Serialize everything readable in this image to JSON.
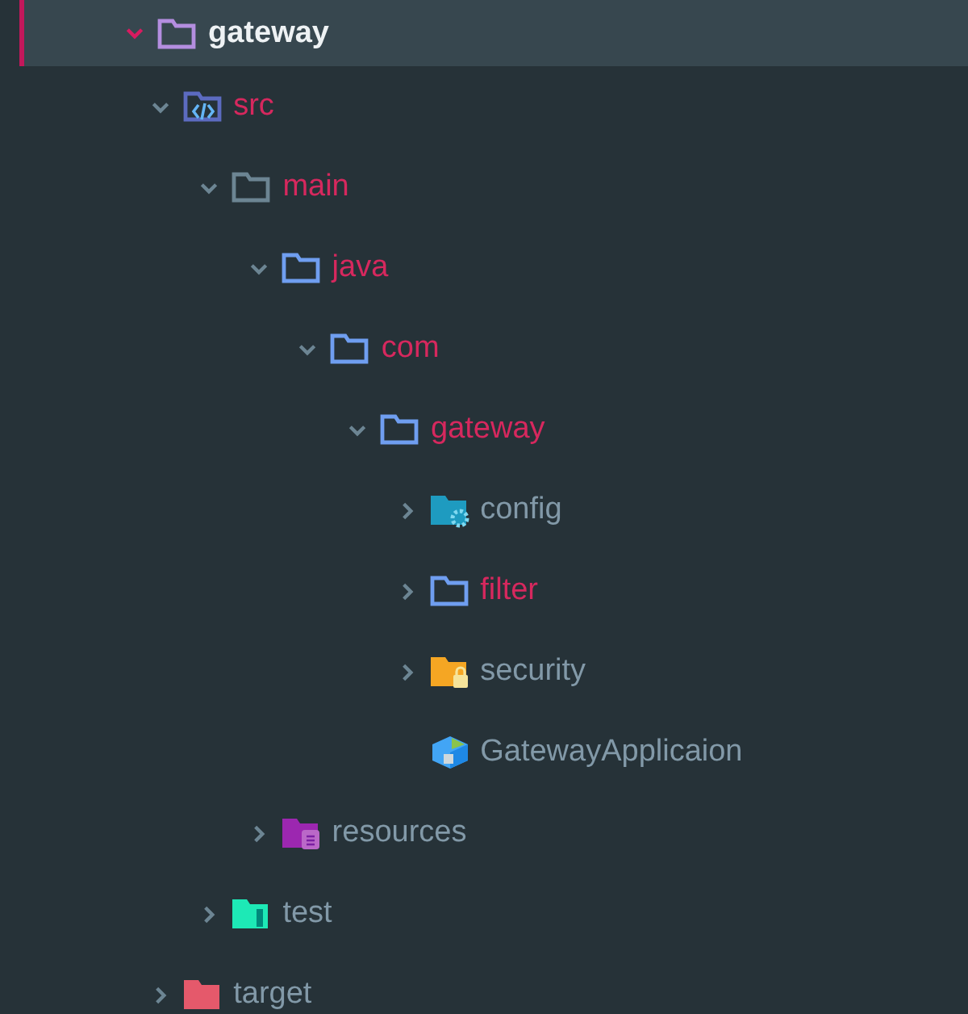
{
  "tree": [
    {
      "label": "gateway",
      "kind": "project-folder",
      "selected": true,
      "expanded": true,
      "children": [
        {
          "label": "src",
          "kind": "src-folder",
          "selected": false,
          "modified": true,
          "expanded": true,
          "children": [
            {
              "label": "main",
              "kind": "folder",
              "selected": false,
              "modified": true,
              "expanded": true,
              "children": [
                {
                  "label": "java",
                  "kind": "package-folder",
                  "selected": false,
                  "modified": true,
                  "expanded": true,
                  "children": [
                    {
                      "label": "com",
                      "kind": "package-folder",
                      "selected": false,
                      "modified": true,
                      "expanded": true,
                      "children": [
                        {
                          "label": "gateway",
                          "kind": "package-folder",
                          "selected": false,
                          "modified": true,
                          "expanded": true,
                          "children": [
                            {
                              "label": "config",
                              "kind": "config-folder",
                              "selected": false,
                              "modified": false,
                              "expanded": false
                            },
                            {
                              "label": "filter",
                              "kind": "package-folder",
                              "selected": false,
                              "modified": true,
                              "expanded": false
                            },
                            {
                              "label": "security",
                              "kind": "security-folder",
                              "selected": false,
                              "modified": false,
                              "expanded": false
                            },
                            {
                              "label": "GatewayApplicaion",
                              "kind": "spring-file",
                              "selected": false,
                              "modified": false
                            }
                          ]
                        }
                      ]
                    }
                  ]
                },
                {
                  "label": "resources",
                  "kind": "resources-folder",
                  "selected": false,
                  "modified": false,
                  "expanded": false
                }
              ]
            },
            {
              "label": "test",
              "kind": "test-folder",
              "selected": false,
              "modified": false,
              "expanded": false
            }
          ]
        },
        {
          "label": "target",
          "kind": "target-folder",
          "selected": false,
          "modified": false,
          "expanded": false
        }
      ]
    }
  ]
}
